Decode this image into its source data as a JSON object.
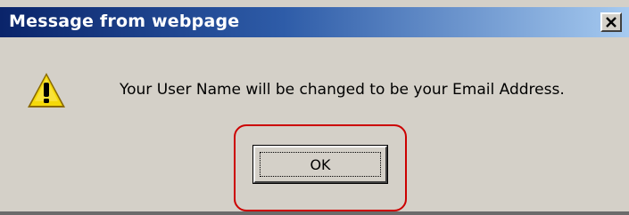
{
  "dialog": {
    "title": "Message from webpage",
    "message": "Your User Name will be changed to be your Email Address.",
    "ok_label": "OK",
    "icon": "warning-icon",
    "close_icon": "close-icon"
  },
  "colors": {
    "titlebar_start": "#0a246a",
    "titlebar_end": "#a6caf0",
    "dialog_bg": "#d4d0c8",
    "highlight": "#cc0000",
    "warning_fill": "#f5d90a"
  }
}
